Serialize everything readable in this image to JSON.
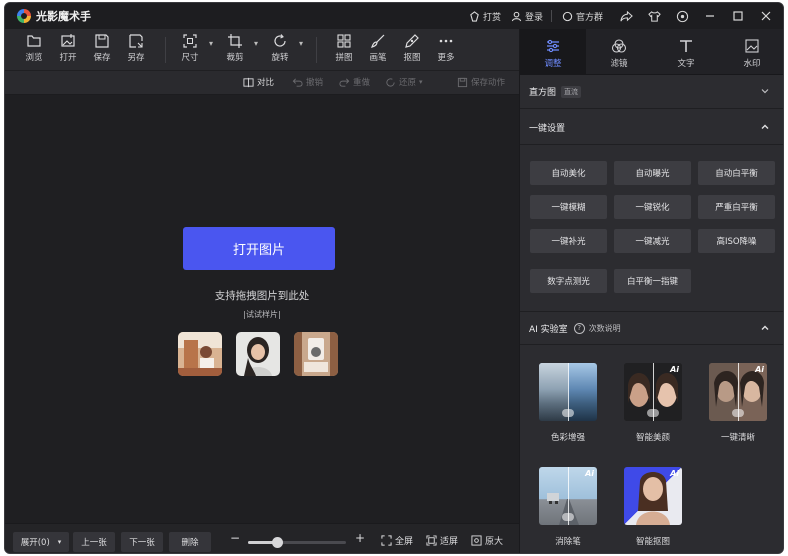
{
  "app": {
    "title": "光影魔术手"
  },
  "titlebar": {
    "reward": "打赏",
    "login": "登录",
    "group": "官方群"
  },
  "toolbar": {
    "tools": [
      {
        "label": "浏览",
        "icon": "folder-icon"
      },
      {
        "label": "打开",
        "icon": "image-open-icon"
      },
      {
        "label": "保存",
        "icon": "save-icon"
      },
      {
        "label": "另存",
        "icon": "save-as-icon"
      },
      {
        "label": "尺寸",
        "icon": "resize-icon"
      },
      {
        "label": "裁剪",
        "icon": "crop-icon"
      },
      {
        "label": "旋转",
        "icon": "rotate-icon"
      },
      {
        "label": "拼图",
        "icon": "collage-icon"
      },
      {
        "label": "画笔",
        "icon": "brush-icon"
      },
      {
        "label": "抠图",
        "icon": "cutout-icon"
      },
      {
        "label": "更多",
        "icon": "more-icon"
      }
    ]
  },
  "subbar": {
    "compare": "对比",
    "undo": "撤销",
    "redo": "重做",
    "restore": "还原",
    "save_action": "保存动作"
  },
  "canvas": {
    "open_button": "打开图片",
    "hint": "支持拖拽图片到此处",
    "sample_label": "|试试样片|"
  },
  "bottombar": {
    "expand": "展开(0)",
    "prev": "上一张",
    "next": "下一张",
    "delete": "删除",
    "fullscreen": "全屏",
    "fit": "适屏",
    "original": "原大",
    "zoom_fraction": 0.3
  },
  "rightpanel": {
    "tabs": [
      {
        "label": "调整",
        "active": true
      },
      {
        "label": "滤镜",
        "active": false
      },
      {
        "label": "文字",
        "active": false
      },
      {
        "label": "水印",
        "active": false
      }
    ],
    "histogram": {
      "title": "直方图",
      "badge": "直流"
    },
    "oneclick": {
      "title": "一键设置",
      "buttons": [
        "自动美化",
        "自动曝光",
        "自动白平衡",
        "一键模糊",
        "一键锐化",
        "严重白平衡",
        "一键补光",
        "一键减光",
        "高ISO降噪",
        "数字点测光",
        "白平衡一指键"
      ]
    },
    "ailab": {
      "title": "AI 实验室",
      "help": "次数说明",
      "items": [
        "色彩增强",
        "智能美颜",
        "一键清晰",
        "消除笔",
        "智能抠图"
      ],
      "ai_tag": "Ai"
    }
  },
  "colors": {
    "accent": "#4a56f0",
    "active_tab_text": "#6f8cff",
    "background": "#242427"
  }
}
